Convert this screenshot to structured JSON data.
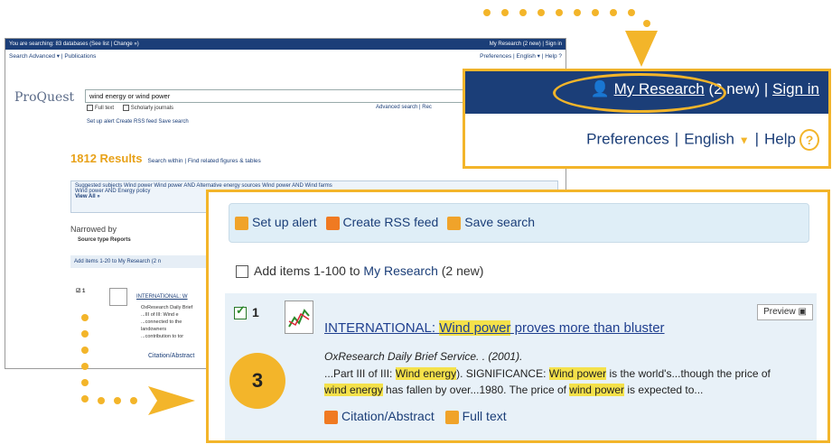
{
  "background": {
    "searching_text": "You are searching: 83 databases (See list | Change »)",
    "top_right": "My Research (2 new) | Sign in",
    "nav_left": "Search  Advanced ▾ | Publications",
    "nav_right": "Preferences | English ▾ | Help ?",
    "logo": "ProQuest",
    "search_value": "wind energy or wind power",
    "fulltext": "Full text",
    "scholarly": "Scholarly journals",
    "advanced_link": "Advanced search | Rec",
    "tools": "Set up alert   Create RSS feed   Save search",
    "results_count": "1812 Results",
    "results_links": "Search within | Find related figures & tables",
    "suggested": "Suggested subjects  Wind power  Wind power AND Alternative energy sources  Wind power AND Wind farms",
    "suggested2": "Wind power AND Energy policy",
    "view_all": "View All »",
    "narrowed": "Narrowed by",
    "source_type": "Source type Reports",
    "add_items_small": "Add items 1-20 to My Research (2 n",
    "item_small_title": "INTERNATIONAL: W",
    "item_small_lines": [
      "OxResearch Daily Brief",
      "...III of III: Wind e",
      "...connected to the",
      "landowners",
      "...contribution to tor"
    ],
    "citation_small": "Citation/Abstract"
  },
  "zoom1": {
    "my_research": "My Research",
    "new_count": "(2 new)",
    "sign_in": "Sign in",
    "preferences": "Preferences",
    "language": "English",
    "help": "Help",
    "help_icon": "?"
  },
  "zoom2": {
    "set_up_alert": "Set up alert",
    "create_rss": "Create RSS feed",
    "save_search": "Save search",
    "add_items_prefix": "Add items 1-100 to ",
    "my_research": "My Research",
    "add_items_suffix": " (2 new)",
    "result_number": "1",
    "preview": "Preview",
    "title_a": "INTERNATIONAL: ",
    "title_hl": "Wind power",
    "title_b": " proves more than bluster",
    "source": "OxResearch Daily Brief Service. . (2001).",
    "snip_1": "...Part III of III: ",
    "snip_hl1": "Wind energy",
    "snip_2": "). SIGNIFICANCE: ",
    "snip_hl2": "Wind power",
    "snip_3": " is the world's...though the price of",
    "snip_hl3": "wind energy",
    "snip_4": " has fallen by over...1980. The price of ",
    "snip_hl4": "wind power",
    "snip_5": " is expected to...",
    "citation": "Citation/Abstract",
    "full_text": "Full text"
  },
  "callout_number": "3",
  "colors": {
    "accent": "#f3b52a",
    "navy": "#1b3e78",
    "highlight": "#f4e14a"
  }
}
